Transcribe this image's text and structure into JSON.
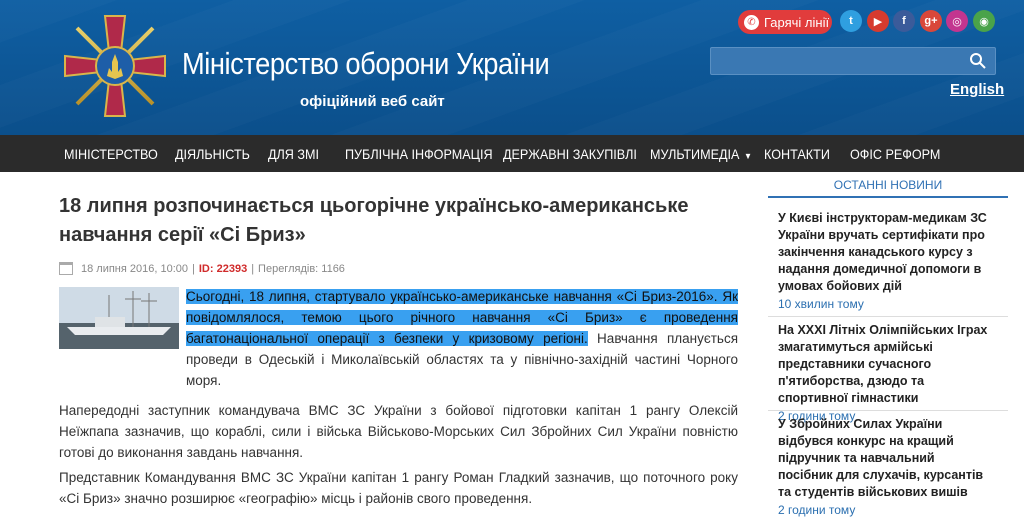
{
  "header": {
    "title": "Міністерство оборони України",
    "subtitle": "офіційний веб сайт",
    "hotline_label": "Гарячі лінії",
    "search_placeholder": "",
    "language_link": "English",
    "social": [
      "twitter-icon",
      "youtube-icon",
      "facebook-icon",
      "google-plus-icon",
      "instagram-icon",
      "accessibility-icon"
    ],
    "colors": {
      "header_bg": "#0b4f8b",
      "nav_bg": "#2b2b2b",
      "hotline_bg": "#e13c3c",
      "accent": "#3071b4",
      "highlight": "#39a0f0"
    }
  },
  "nav": {
    "items": [
      "МІНІСТЕРСТВО",
      "ДІЯЛЬНІСТЬ",
      "ДЛЯ ЗМІ",
      "ПУБЛІЧНА ІНФОРМАЦІЯ",
      "ДЕРЖАВНІ ЗАКУПІВЛІ",
      "МУЛЬТИМЕДІА",
      "КОНТАКТИ",
      "ОФІС РЕФОРМ"
    ]
  },
  "article": {
    "title": "18 липня розпочинається цьогорічне українсько-американське навчання серії «Сі Бриз»",
    "date": "18 липня 2016, 10:00",
    "id_label": "ID: 22393",
    "views": "Переглядів: 1166",
    "lead_highlighted": "Сьогодні, 18 липня, стартувало українсько-американське навчання «Сі Бриз-2016». Як повідомлялося, темою цього річного навчання «Сі Бриз» є проведення багатонаціональної операції з безпеки у кризовому регіоні.",
    "lead_rest": " Навчання планується проведи в Одеській і Миколаївській областях та у північно-західній частині Чорного моря.",
    "paragraph2": "Напередодні заступник командувача ВМС ЗС України з бойової підготовки капітан 1 рангу Олексій Неїжпапа зазначив, що кораблі, сили і війська Військово-Морських Сил Збройних Сил України повністю готові до виконання завдань навчання.",
    "paragraph3": "Представник Командування ВМС ЗС України капітан 1 рангу Роман Гладкий зазначив, що поточного року «Сі Бриз» значно розширює «географію» місць і районів свого проведення."
  },
  "sidebar": {
    "heading": "ОСТАННІ НОВИНИ",
    "news": [
      {
        "title": "У Києві інструкторам-медикам ЗС України вручать сертифікати про закінчення канадського курсу з надання домедичної допомоги в умовах бойових дій",
        "time": "10 хвилин тому"
      },
      {
        "title": "На ХХХІ Літніх Олімпійських Іграх змагатимуться армійські представники сучасного п'ятиборства, дзюдо та спортивної гімнастики",
        "time": "2 години тому"
      },
      {
        "title": "У Збройних Силах України відбувся конкурс на кращий підручник та навчальний посібник для слухачів, курсантів та студентів військових вишів",
        "time": "2 години тому"
      }
    ]
  }
}
